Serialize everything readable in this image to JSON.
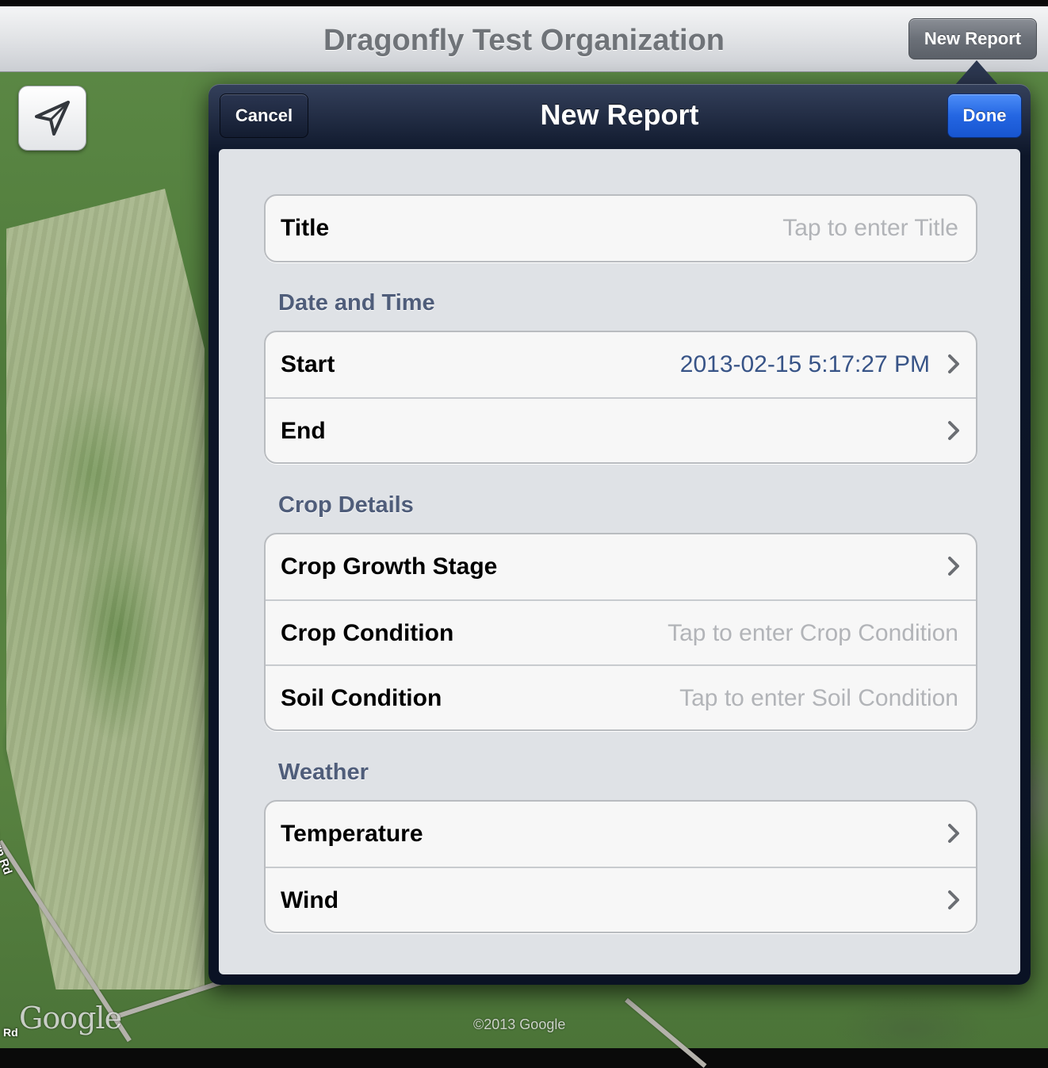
{
  "map": {
    "road_label_1": "Burn Rd",
    "road_label_2": "Rd",
    "google_logo": "Google",
    "copyright": "©2013 Google"
  },
  "topbar": {
    "title": "Dragonfly Test Organization",
    "new_report_label": "New Report"
  },
  "locate_button": {
    "icon": "location-arrow-icon"
  },
  "popover": {
    "title": "New Report",
    "cancel_label": "Cancel",
    "done_label": "Done",
    "title_row": {
      "label": "Title",
      "placeholder": "Tap to enter Title"
    },
    "sections": {
      "date_time": {
        "header": "Date and Time",
        "start_label": "Start",
        "start_value": "2013-02-15 5:17:27 PM",
        "end_label": "End"
      },
      "crop": {
        "header": "Crop Details",
        "growth_stage_label": "Crop Growth Stage",
        "condition_label": "Crop Condition",
        "condition_placeholder": "Tap to enter Crop Condition",
        "soil_label": "Soil Condition",
        "soil_placeholder": "Tap to enter Soil Condition"
      },
      "weather": {
        "header": "Weather",
        "temperature_label": "Temperature",
        "wind_label": "Wind"
      }
    }
  },
  "colors": {
    "done_blue": "#2466e2",
    "header_text": "#4f5d7a",
    "value_text": "#385487",
    "placeholder_text": "#b2b4b8",
    "popover_dark": "#0d1629"
  }
}
